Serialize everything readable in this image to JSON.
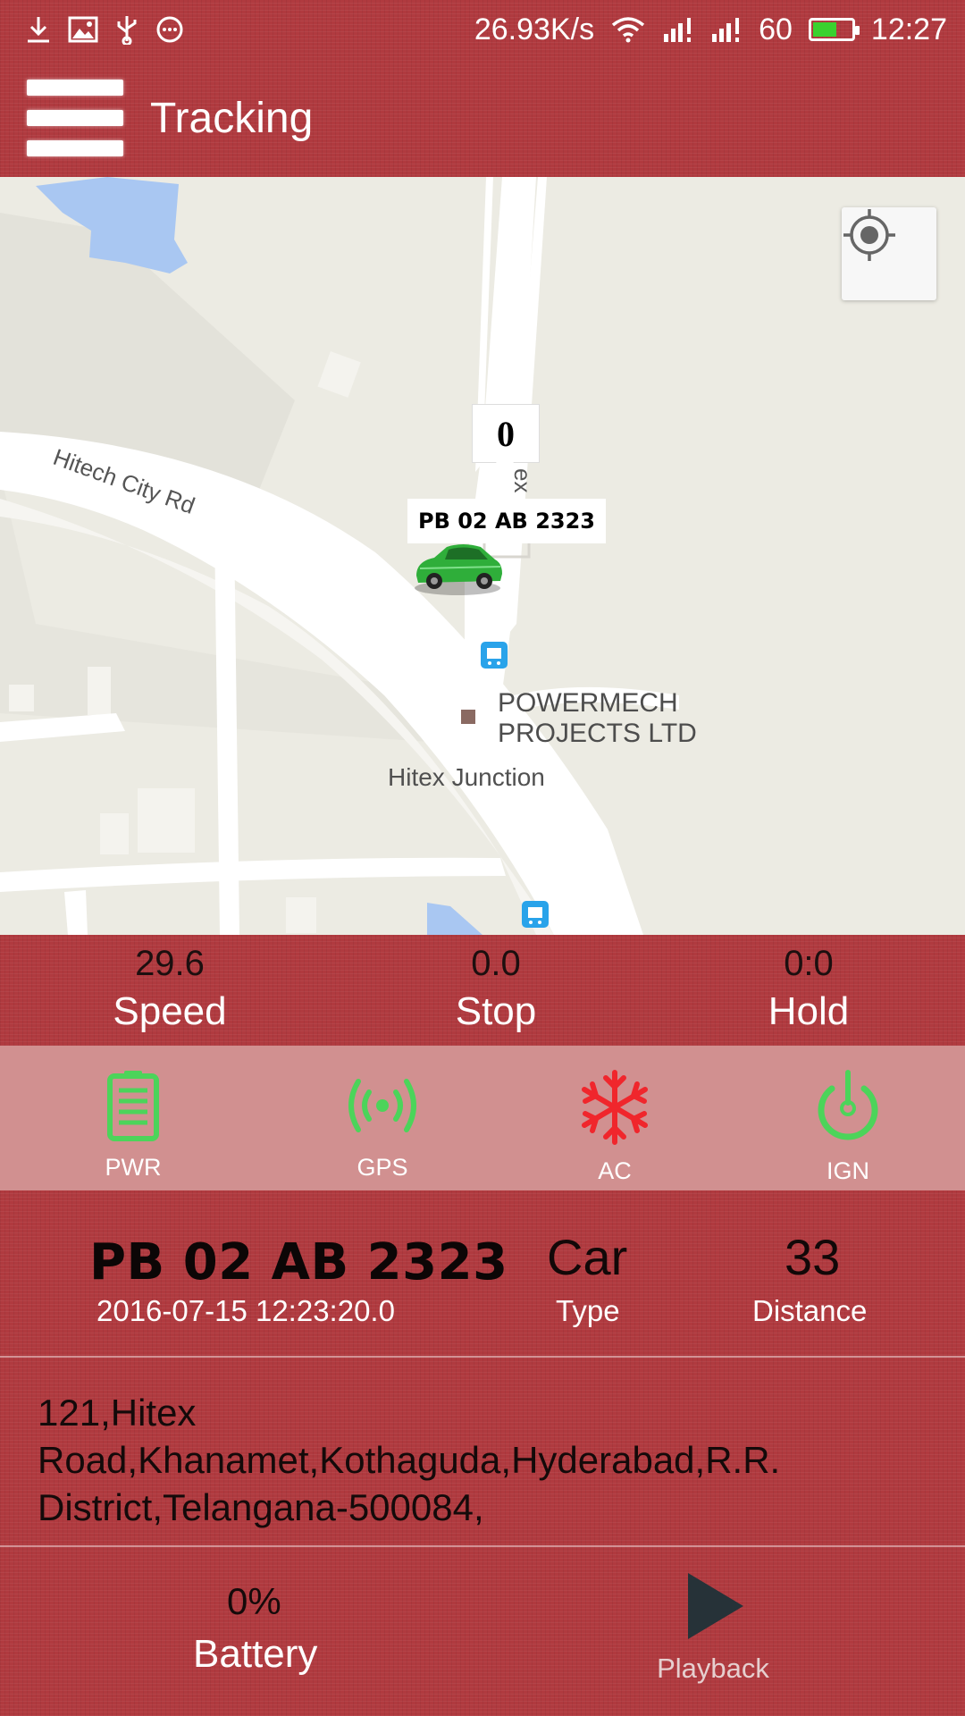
{
  "status_bar": {
    "net_speed": "26.93K/s",
    "signal_text": "60",
    "battery_level": 0.6,
    "time": "12:27"
  },
  "app_bar": {
    "title": "Tracking",
    "menu_icon": "hamburger-menu-icon"
  },
  "map": {
    "count_badge": "0",
    "vehicle_label": "PB 02 AB 2323",
    "road_hitech": "Hitech City Rd",
    "road_hitex_partial": "ex",
    "poi_line1": "POWERMECH",
    "poi_line2": "PROJECTS LTD",
    "junction": "Hitex Junction",
    "locate_icon": "my-location-icon"
  },
  "stats": {
    "speed_value": "29.6",
    "speed_label": "Speed",
    "stop_value": "0.0",
    "stop_label": "Stop",
    "hold_value": "0:0",
    "hold_label": "Hold"
  },
  "indicators": [
    {
      "label": "PWR",
      "icon": "battery-icon",
      "color": "#4cd45a"
    },
    {
      "label": "GPS",
      "icon": "gps-signal-icon",
      "color": "#4cd45a"
    },
    {
      "label": "AC",
      "icon": "snowflake-icon",
      "color": "#f0262c"
    },
    {
      "label": "IGN",
      "icon": "power-icon",
      "color": "#4cd45a"
    }
  ],
  "vehicle": {
    "plate": "PB 02 AB 2323",
    "timestamp": "2016-07-15 12:23:20.0",
    "type_value": "Car",
    "type_label": "Type",
    "distance_value": "33",
    "distance_label": "Distance"
  },
  "address": {
    "line1": "121,Hitex",
    "line2": "Road,Khanamet,Kothaguda,Hyderabad,R.R.",
    "line3": "District,Telangana-500084,"
  },
  "footer": {
    "battery_value": "0%",
    "battery_label": "Battery",
    "playback_label": "Playback"
  },
  "colors": {
    "accent_red": "#b03a3f",
    "indicator_band": "#d19090",
    "ok_green": "#4cd45a",
    "ac_red": "#f0262c"
  }
}
